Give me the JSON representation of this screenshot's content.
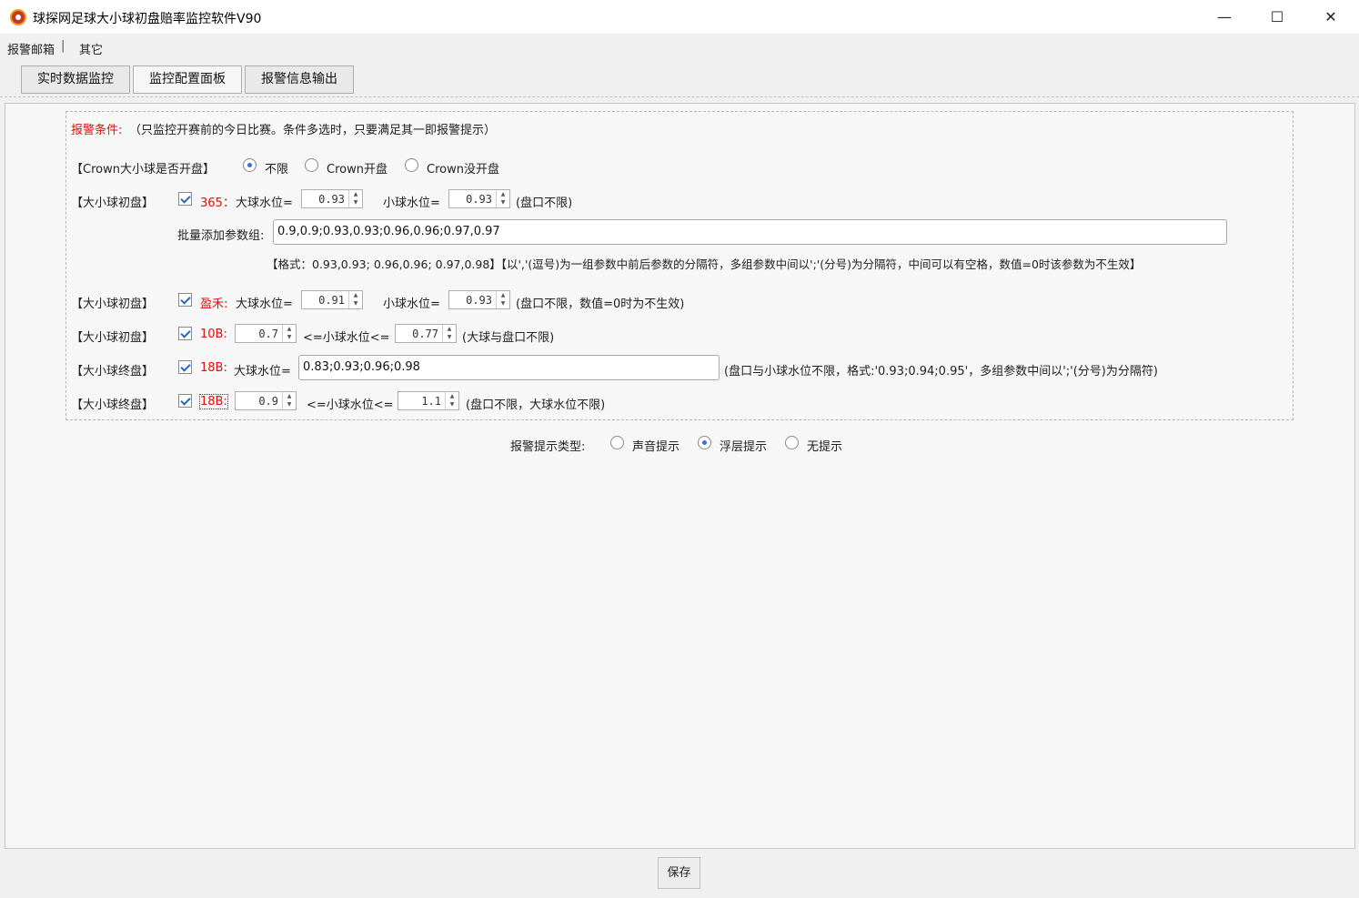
{
  "window": {
    "title": "球探网足球大小球初盘赔率监控软件V90",
    "minimize": "—",
    "maximize": "☐",
    "close": "✕"
  },
  "menu": {
    "items": [
      "报警邮箱",
      "其它"
    ],
    "separator": "|"
  },
  "tabs": [
    {
      "label": "实时数据监控"
    },
    {
      "label": "监控配置面板",
      "active": true
    },
    {
      "label": "报警信息输出"
    }
  ],
  "conditions": {
    "header_label": "报警条件:",
    "header_note": "（只监控开赛前的今日比赛。条件多选时，只要满足其一即报警提示）",
    "crown": {
      "label": "【Crown大小球是否开盘】",
      "options": [
        "不限",
        "Crown开盘",
        "Crown没开盘"
      ],
      "selected": "不限"
    },
    "row1": {
      "label": "【大小球初盘】",
      "checked": true,
      "source": "365：",
      "big_label": "大球水位=",
      "big_value": "0.93",
      "small_label": "小球水位=",
      "small_value": "0.93",
      "note": "(盘口不限)"
    },
    "batch": {
      "label": "批量添加参数组:",
      "value": "0.9,0.9;0.93,0.93;0.96,0.96;0.97,0.97",
      "format_note": "【格式：0.93,0.93; 0.96,0.96; 0.97,0.98】【以','(逗号)为一组参数中前后参数的分隔符，多组参数中间以';'(分号)为分隔符，中间可以有空格，数值=0时该参数为不生效】"
    },
    "row2": {
      "label": "【大小球初盘】",
      "checked": true,
      "source": "盈禾:",
      "big_label": "大球水位=",
      "big_value": "0.91",
      "small_label": "小球水位=",
      "small_value": "0.93",
      "note": "(盘口不限，数值=0时为不生效)"
    },
    "row3": {
      "label": "【大小球初盘】",
      "checked": true,
      "source": "10B:",
      "low_value": "0.7",
      "mid_label": "<=小球水位<=",
      "high_value": "0.77",
      "note": "(大球与盘口不限)"
    },
    "row4": {
      "label": "【大小球终盘】",
      "checked": true,
      "source": "18B:",
      "big_label": "大球水位=",
      "value": "0.83;0.93;0.96;0.98",
      "note": "(盘口与小球水位不限，格式:'0.93;0.94;0.95'，多组参数中间以';'(分号)为分隔符)"
    },
    "row5": {
      "label": "【大小球终盘】",
      "checked": true,
      "source": "18B:",
      "low_value": "0.9",
      "mid_label": "<=小球水位<=",
      "high_value": "1.1",
      "note": "(盘口不限，大球水位不限)"
    }
  },
  "alert_type": {
    "label": "报警提示类型:",
    "options": [
      "声音提示",
      "浮层提示",
      "无提示"
    ],
    "selected": "浮层提示"
  },
  "save_label": "保存"
}
